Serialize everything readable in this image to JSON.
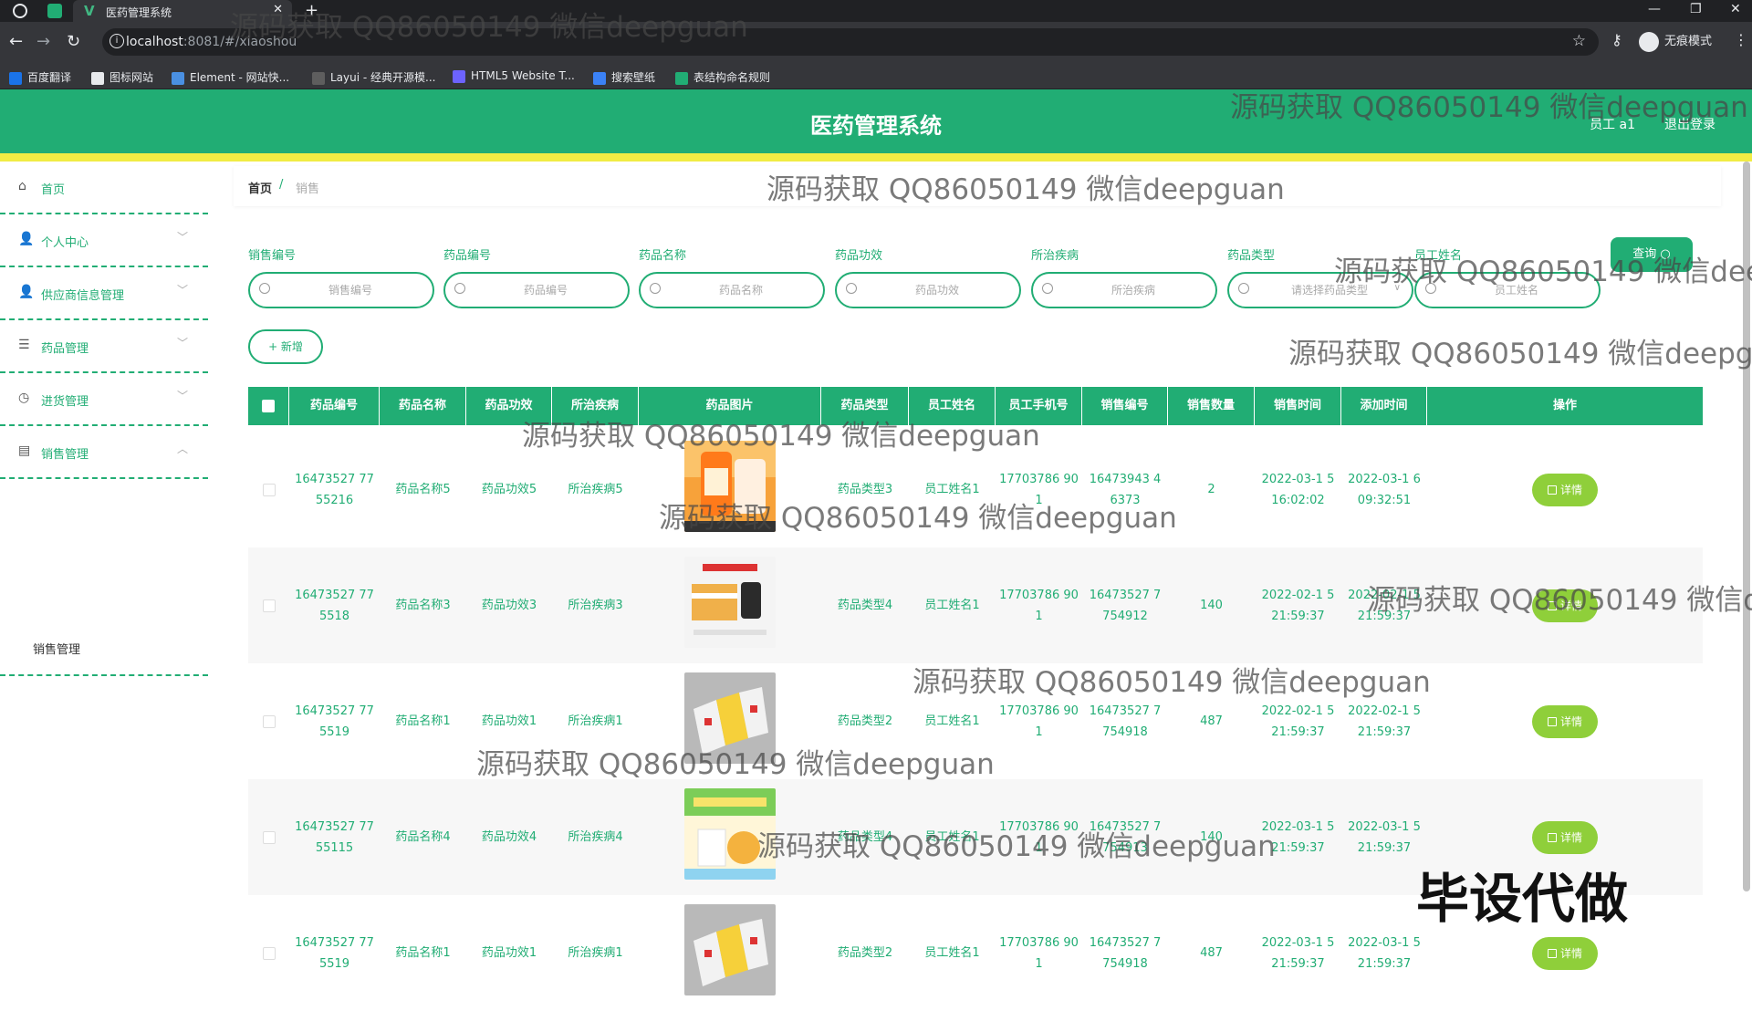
{
  "browser": {
    "tab_title": "医药管理系统",
    "url_host": "localhost",
    "url_path": ":8081/#/xiaoshou",
    "profile_label": "无痕模式",
    "bookmarks": [
      {
        "label": "百度翻译",
        "color": "#1a73e8"
      },
      {
        "label": "图标网站",
        "color": "#e8eaed"
      },
      {
        "label": "Element - 网站快...",
        "color": "#4a90e2"
      },
      {
        "label": "Layui - 经典开源模...",
        "color": "#5e5e5e"
      },
      {
        "label": "HTML5 Website T...",
        "color": "#6c63ff"
      },
      {
        "label": "搜索壁纸",
        "color": "#3b82f6"
      },
      {
        "label": "表结构命名规则",
        "color": "#21ad74"
      }
    ]
  },
  "header": {
    "title": "医药管理系统",
    "user": "员工 a1",
    "logout": "退出登录",
    "accent_color": "#21ad74"
  },
  "sidebar": {
    "items": [
      {
        "label": "首页",
        "icon": "home-icon"
      },
      {
        "label": "个人中心",
        "icon": "user-icon"
      },
      {
        "label": "供应商信息管理",
        "icon": "supplier-icon"
      },
      {
        "label": "药品管理",
        "icon": "list-icon"
      },
      {
        "label": "进货管理",
        "icon": "clock-icon"
      },
      {
        "label": "销售管理",
        "icon": "sales-icon"
      }
    ],
    "sub_item": "销售管理"
  },
  "breadcrumb": {
    "home": "首页",
    "separator": "/",
    "current": "销售"
  },
  "filters": [
    {
      "label": "销售编号",
      "placeholder": "销售编号"
    },
    {
      "label": "药品编号",
      "placeholder": "药品编号"
    },
    {
      "label": "药品名称",
      "placeholder": "药品名称"
    },
    {
      "label": "药品功效",
      "placeholder": "药品功效"
    },
    {
      "label": "所治疾病",
      "placeholder": "所治疾病"
    },
    {
      "label": "药品类型",
      "placeholder": "请选择药品类型"
    },
    {
      "label": "员工姓名",
      "placeholder": "员工姓名"
    }
  ],
  "buttons": {
    "query": "查询 ○",
    "add": "+ 新增",
    "detail": "详情"
  },
  "table": {
    "columns": [
      "药品编号",
      "药品名称",
      "药品功效",
      "所治疾病",
      "药品图片",
      "药品类型",
      "员工姓名",
      "员工手机号",
      "销售编号",
      "销售数量",
      "销售时间",
      "添加时间",
      "操作"
    ],
    "rows": [
      {
        "drug_no": "16473527 7755216",
        "name": "药品名称5",
        "effect": "药品功效5",
        "disease": "所治疾病5",
        "type": "药品类型3",
        "employee": "员工姓名1",
        "phone": "17703786 901",
        "sale_no": "16473943 46373",
        "qty": "2",
        "sale_time": "2022-03-1 5 16:02:02",
        "add_time": "2022-03-1 6 09:32:51",
        "img": "orange"
      },
      {
        "drug_no": "16473527 775518",
        "name": "药品名称3",
        "effect": "药品功效3",
        "disease": "所治疾病3",
        "type": "药品类型4",
        "employee": "员工姓名1",
        "phone": "17703786 901",
        "sale_no": "16473527 7754912",
        "qty": "140",
        "sale_time": "2022-02-1 5 21:59:37",
        "add_time": "2022-02-1 5 21:59:37",
        "img": "boxes"
      },
      {
        "drug_no": "16473527 775519",
        "name": "药品名称1",
        "effect": "药品功效1",
        "disease": "所治疾病1",
        "type": "药品类型2",
        "employee": "员工姓名1",
        "phone": "17703786 901",
        "sale_no": "16473527 7754918",
        "qty": "487",
        "sale_time": "2022-02-1 5 21:59:37",
        "add_time": "2022-02-1 5 21:59:37",
        "img": "packs"
      },
      {
        "drug_no": "16473527 7755115",
        "name": "药品名称4",
        "effect": "药品功效4",
        "disease": "所治疾病4",
        "type": "药品类型4",
        "employee": "员工姓名1",
        "phone": "17703786 901",
        "sale_no": "16473527 7754913",
        "qty": "140",
        "sale_time": "2022-03-1 5 21:59:37",
        "add_time": "2022-03-1 5 21:59:37",
        "img": "vitamin"
      },
      {
        "drug_no": "16473527 775519",
        "name": "药品名称1",
        "effect": "药品功效1",
        "disease": "所治疾病1",
        "type": "药品类型2",
        "employee": "员工姓名1",
        "phone": "17703786 901",
        "sale_no": "16473527 7754918",
        "qty": "487",
        "sale_time": "2022-03-1 5 21:59:37",
        "add_time": "2022-03-1 5 21:59:37",
        "img": "packs"
      }
    ]
  },
  "watermark": "源码获取 QQ86050149 微信deepguan",
  "promo_text": "毕设代做"
}
